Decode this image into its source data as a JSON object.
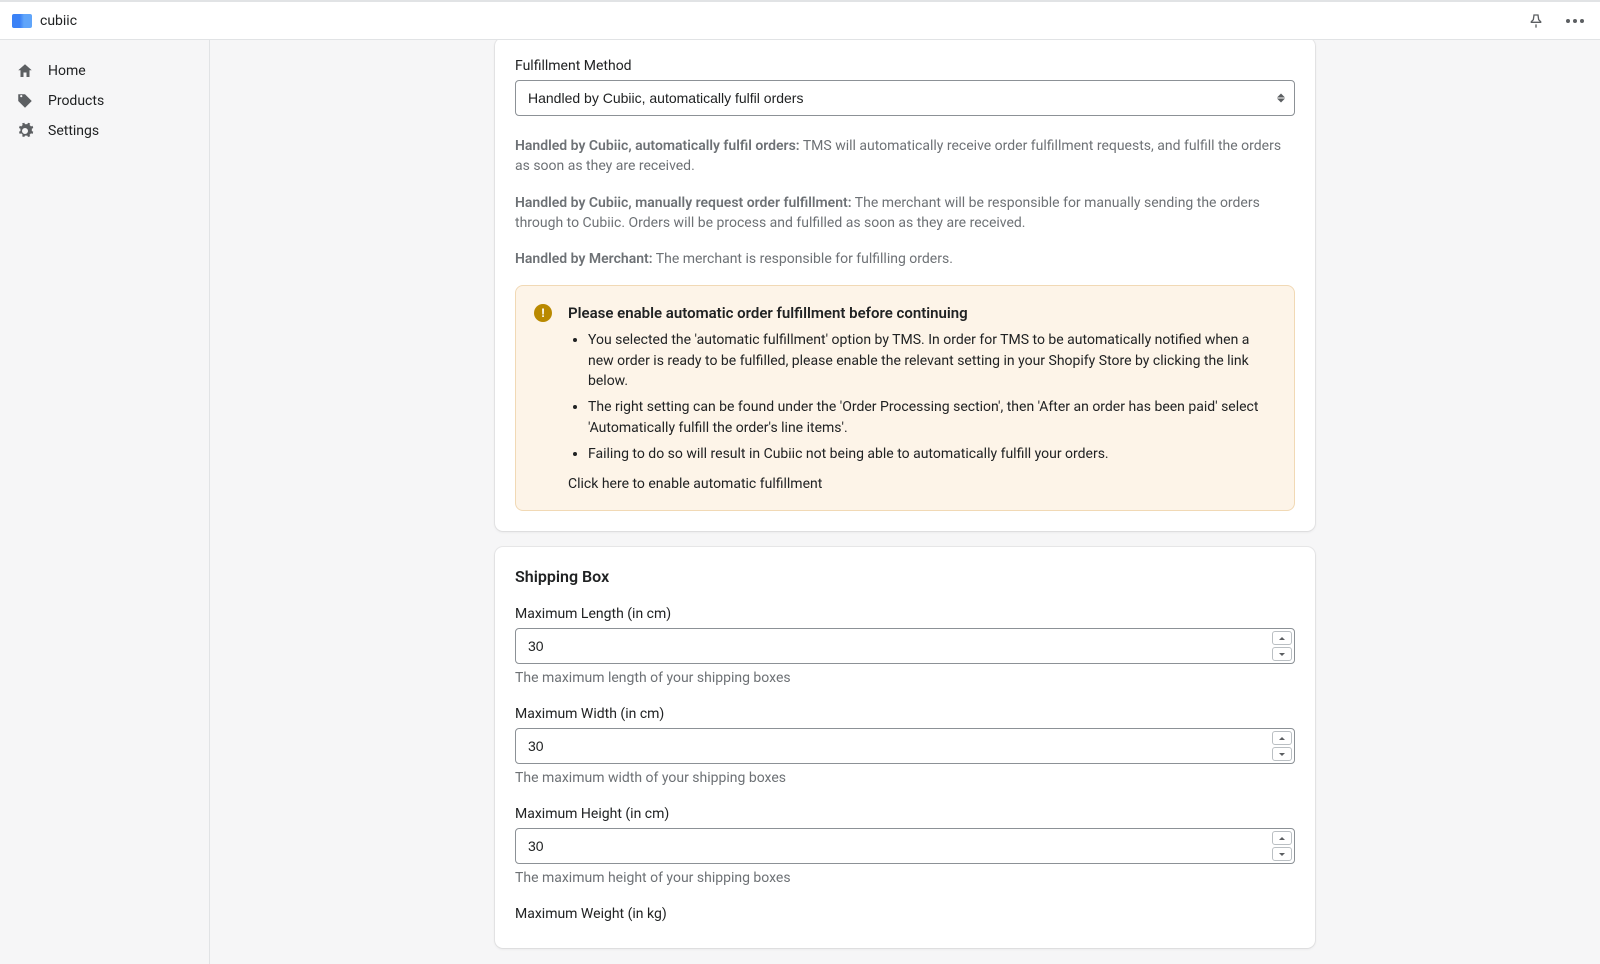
{
  "topbar": {
    "app_name": "cubiic"
  },
  "sidebar": {
    "items": [
      {
        "label": "Home"
      },
      {
        "label": "Products"
      },
      {
        "label": "Settings"
      }
    ]
  },
  "fulfillment": {
    "label": "Fulfillment Method",
    "selected": "Handled by Cubiic, automatically fulfil orders",
    "descriptions": {
      "auto_term": "Handled by Cubiic, automatically fulfil orders:",
      "auto_text": "TMS will automatically receive order fulfillment requests, and fulfill the orders as soon as they are received.",
      "manual_term": "Handled by Cubiic, manually request order fulfillment:",
      "manual_text": "The merchant will be responsible for manually sending the orders through to Cubiic. Orders will be process and fulfilled as soon as they are received.",
      "merchant_term": "Handled by Merchant:",
      "merchant_text": "The merchant is responsible for fulfilling orders."
    }
  },
  "alert": {
    "title": "Please enable automatic order fulfillment before continuing",
    "items": [
      "You selected the 'automatic fulfillment' option by TMS. In order for TMS to be automatically notified when a new order is ready to be fulfilled, please enable the relevant setting in your Shopify Store by clicking the link below.",
      "The right setting can be found under the 'Order Processing section', then 'After an order has been paid' select 'Automatically fulfill the order's line items'.",
      "Failing to do so will result in Cubiic not being able to automatically fulfill your orders."
    ],
    "link_text": "Click here to enable automatic fulfillment"
  },
  "shipping": {
    "heading": "Shipping Box",
    "length": {
      "label": "Maximum Length (in cm)",
      "value": "30",
      "help": "The maximum length of your shipping boxes"
    },
    "width": {
      "label": "Maximum Width (in cm)",
      "value": "30",
      "help": "The maximum width of your shipping boxes"
    },
    "height": {
      "label": "Maximum Height (in cm)",
      "value": "30",
      "help": "The maximum height of your shipping boxes"
    },
    "weight": {
      "label": "Maximum Weight (in kg)"
    }
  }
}
